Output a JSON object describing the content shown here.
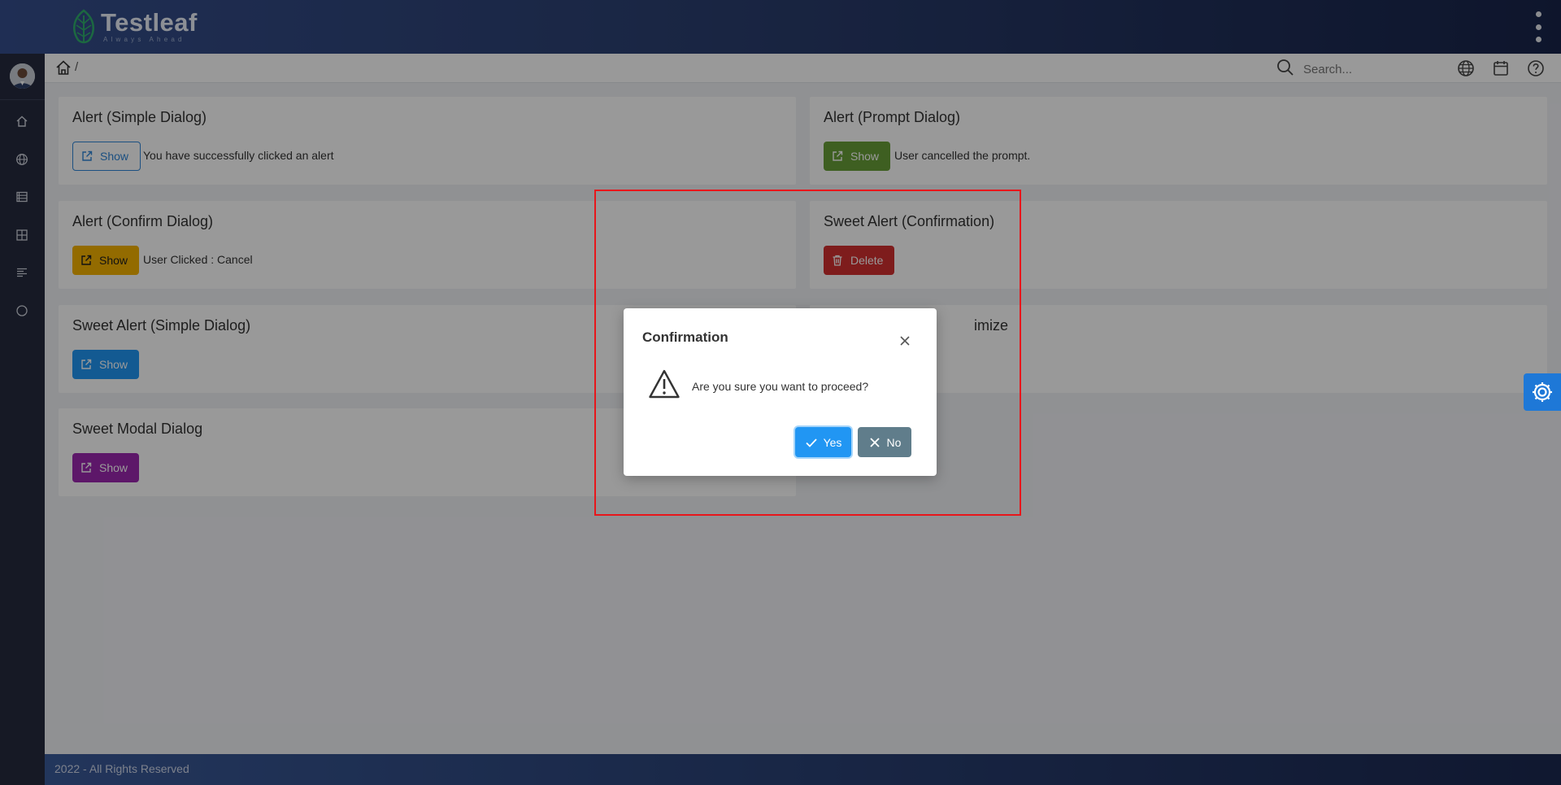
{
  "header": {
    "brand_name": "Testleaf",
    "brand_tagline": "Always Ahead"
  },
  "breadcrumb": {
    "separator": "/"
  },
  "search": {
    "placeholder": "Search..."
  },
  "cards": {
    "simple_alert": {
      "title": "Alert (Simple Dialog)",
      "button": "Show",
      "result": "You have successfully clicked an alert"
    },
    "prompt_alert": {
      "title": "Alert (Prompt Dialog)",
      "button": "Show",
      "result": "User cancelled the prompt."
    },
    "confirm_alert": {
      "title": "Alert (Confirm Dialog)",
      "button": "Show",
      "result": "User Clicked : Cancel"
    },
    "sweet_confirm": {
      "title": "Sweet Alert (Confirmation)",
      "button": "Delete"
    },
    "sweet_simple": {
      "title": "Sweet Alert (Simple Dialog)",
      "button": "Show"
    },
    "minimize": {
      "title_partial": "imize"
    },
    "sweet_modal": {
      "title": "Sweet Modal Dialog",
      "button": "Show"
    }
  },
  "footer": {
    "text": "2022 - All Rights Reserved"
  },
  "dialog": {
    "title": "Confirmation",
    "message": "Are you sure you want to proceed?",
    "yes_label": "Yes",
    "no_label": "No"
  },
  "colors": {
    "primary": "#2196f3",
    "success": "#689f38",
    "warning": "#f5b301",
    "danger": "#d32f2f",
    "help": "#9c27b0",
    "secondary": "#607d8b",
    "highlight_border": "#e8161b"
  },
  "icons": {
    "brand": "leaf-logo-icon",
    "menu": "kebab-menu-icon",
    "home": "home-icon",
    "search": "search-icon",
    "language": "globe-icon",
    "calendar": "calendar-icon",
    "help": "question-icon",
    "external": "external-link-icon",
    "trash": "trash-icon",
    "warning": "warning-icon",
    "close": "close-icon",
    "check": "check-icon",
    "times": "times-icon",
    "settings": "gear-icon"
  }
}
